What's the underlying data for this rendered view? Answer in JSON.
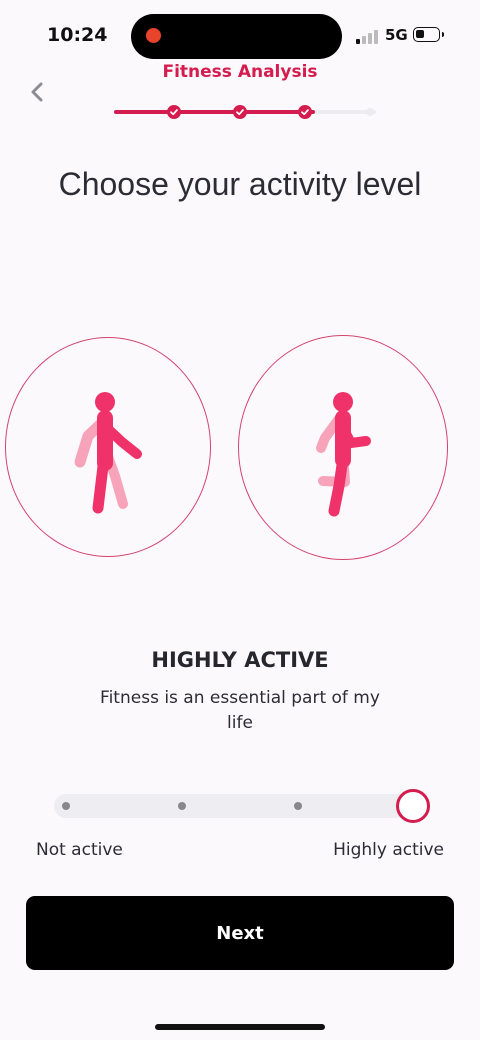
{
  "status_bar": {
    "time": "10:24",
    "network": "5G"
  },
  "header": {
    "title": "Fitness Analysis",
    "back_icon": "chevron-left-icon"
  },
  "progress": {
    "total_steps": 4,
    "completed_steps": 3
  },
  "page_title": "Choose your activity level",
  "options": [
    {
      "icon": "walking-person-icon"
    },
    {
      "icon": "running-person-icon"
    }
  ],
  "selected_level": {
    "title": "HIGHLY ACTIVE",
    "description": "Fitness is an essential part of my life"
  },
  "slider": {
    "positions": 4,
    "selected_index": 3,
    "min_label": "Not active",
    "max_label": "Highly active"
  },
  "next_button": {
    "label": "Next"
  },
  "colors": {
    "accent": "#d41c4e",
    "figure": "#f0326a",
    "figure_light": "#f7a3ba",
    "button": "#000000"
  }
}
